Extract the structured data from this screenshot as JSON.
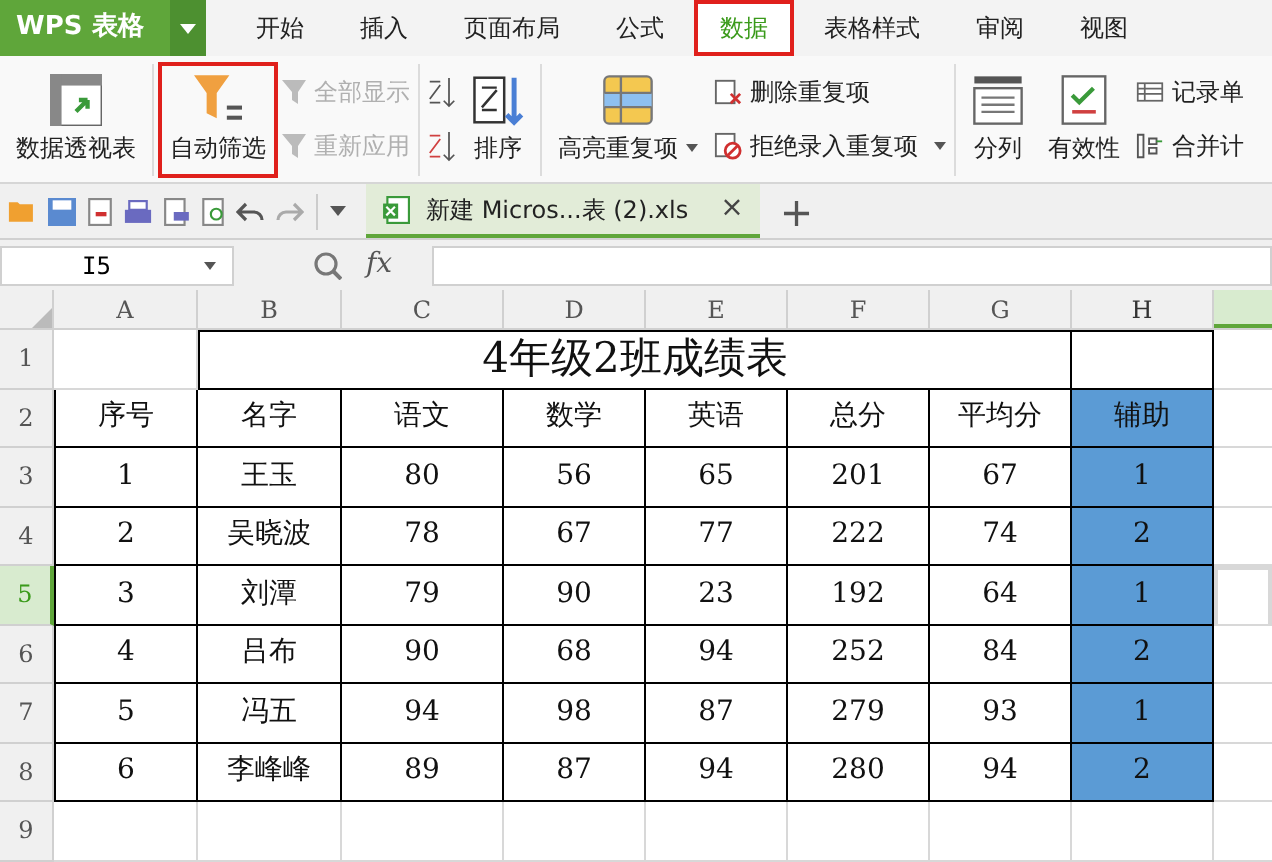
{
  "app_button": {
    "label": "WPS 表格"
  },
  "tabs": [
    {
      "label": "开始",
      "selected": false,
      "highlighted": false
    },
    {
      "label": "插入",
      "selected": false,
      "highlighted": false
    },
    {
      "label": "页面布局",
      "selected": false,
      "highlighted": false
    },
    {
      "label": "公式",
      "selected": false,
      "highlighted": false
    },
    {
      "label": "数据",
      "selected": true,
      "highlighted": true
    },
    {
      "label": "表格样式",
      "selected": false,
      "highlighted": false
    },
    {
      "label": "审阅",
      "selected": false,
      "highlighted": false
    },
    {
      "label": "视图",
      "selected": false,
      "highlighted": false
    }
  ],
  "ribbon": {
    "groups": [
      {
        "items": [
          {
            "kind": "large",
            "label": "数据透视表",
            "disabled": false,
            "highlighted": false,
            "dropdown": false
          }
        ]
      },
      {
        "items": [
          {
            "kind": "large",
            "label": "自动筛选",
            "disabled": false,
            "highlighted": true,
            "dropdown": false
          },
          {
            "kind": "small",
            "label": "全部显示",
            "disabled": true,
            "highlighted": false,
            "dropdown": false
          },
          {
            "kind": "small",
            "label": "重新应用",
            "disabled": true,
            "highlighted": false,
            "dropdown": false
          }
        ]
      },
      {
        "items": [
          {
            "kind": "iconpair",
            "disabled": false,
            "highlighted": false,
            "dropdown": false
          },
          {
            "kind": "large",
            "label": "排序",
            "disabled": false,
            "highlighted": false,
            "dropdown": false
          }
        ]
      },
      {
        "items": [
          {
            "kind": "large",
            "label": "高亮重复项",
            "disabled": false,
            "highlighted": false,
            "dropdown": true
          },
          {
            "kind": "small",
            "label": "删除重复项",
            "disabled": false,
            "highlighted": false,
            "dropdown": false
          },
          {
            "kind": "small",
            "label": "拒绝录入重复项",
            "disabled": false,
            "highlighted": false,
            "dropdown": true
          }
        ]
      },
      {
        "items": [
          {
            "kind": "large",
            "label": "分列",
            "disabled": false,
            "highlighted": false,
            "dropdown": false
          },
          {
            "kind": "large",
            "label": "有效性",
            "disabled": false,
            "highlighted": false,
            "dropdown": false
          },
          {
            "kind": "small",
            "label": "记录单",
            "disabled": false,
            "highlighted": false,
            "dropdown": false
          },
          {
            "kind": "small",
            "label": "合并计",
            "disabled": false,
            "highlighted": false,
            "dropdown": false
          }
        ]
      }
    ]
  },
  "document_tab": {
    "label": "新建 Micros...表 (2).xls",
    "close": "×",
    "new_tab": "+"
  },
  "formula_bar": {
    "name_box": "I5",
    "fx": "fx"
  },
  "sheet": {
    "columns": [
      {
        "letter": "A",
        "highlighted": false
      },
      {
        "letter": "B",
        "highlighted": false
      },
      {
        "letter": "C",
        "highlighted": false
      },
      {
        "letter": "D",
        "highlighted": false
      },
      {
        "letter": "E",
        "highlighted": false
      },
      {
        "letter": "F",
        "highlighted": false
      },
      {
        "letter": "G",
        "highlighted": false
      },
      {
        "letter": "H",
        "highlighted": true
      }
    ],
    "next_column_selected": true,
    "rows": [
      {
        "number": "1",
        "selected": false,
        "kind": "title",
        "title": "4年级2班成绩表"
      },
      {
        "number": "2",
        "selected": false,
        "kind": "table",
        "cells": [
          "序号",
          "名字",
          "语文",
          "数学",
          "英语",
          "总分",
          "平均分",
          "辅助"
        ]
      },
      {
        "number": "3",
        "selected": false,
        "kind": "table",
        "cells": [
          "1",
          "王玉",
          "80",
          "56",
          "65",
          "201",
          "67",
          "1"
        ]
      },
      {
        "number": "4",
        "selected": false,
        "kind": "table",
        "cells": [
          "2",
          "吴晓波",
          "78",
          "67",
          "77",
          "222",
          "74",
          "2"
        ]
      },
      {
        "number": "5",
        "selected": true,
        "kind": "table",
        "cells": [
          "3",
          "刘潭",
          "79",
          "90",
          "23",
          "192",
          "64",
          "1"
        ]
      },
      {
        "number": "6",
        "selected": false,
        "kind": "table",
        "cells": [
          "4",
          "吕布",
          "90",
          "68",
          "94",
          "252",
          "84",
          "2"
        ]
      },
      {
        "number": "7",
        "selected": false,
        "kind": "table",
        "cells": [
          "5",
          "冯五",
          "94",
          "98",
          "87",
          "279",
          "93",
          "1"
        ]
      },
      {
        "number": "8",
        "selected": false,
        "kind": "table",
        "cells": [
          "6",
          "李峰峰",
          "89",
          "87",
          "94",
          "280",
          "94",
          "2"
        ]
      },
      {
        "number": "9",
        "selected": false,
        "kind": "empty"
      }
    ]
  }
}
